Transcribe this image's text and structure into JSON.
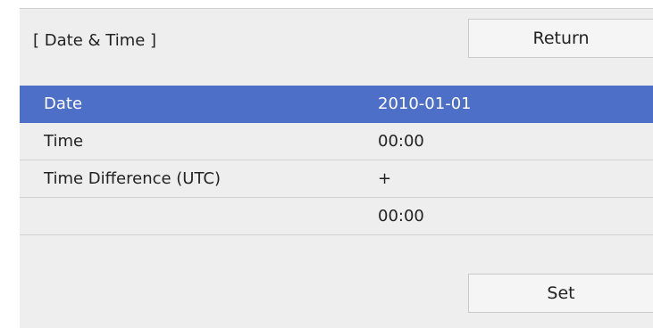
{
  "header": {
    "title": "[ Date & Time ]",
    "return_label": "Return"
  },
  "rows": [
    {
      "label": "Date",
      "value": "2010-01-01",
      "selected": true
    },
    {
      "label": "Time",
      "value": "00:00",
      "selected": false
    },
    {
      "label": "Time Difference (UTC)",
      "value": "+",
      "selected": false
    },
    {
      "label": "",
      "value": "00:00",
      "selected": false
    }
  ],
  "footer": {
    "set_label": "Set"
  },
  "colors": {
    "selected_row": "#4e6fc7",
    "panel_background": "#eeeeee",
    "button_background": "#f5f5f5"
  }
}
